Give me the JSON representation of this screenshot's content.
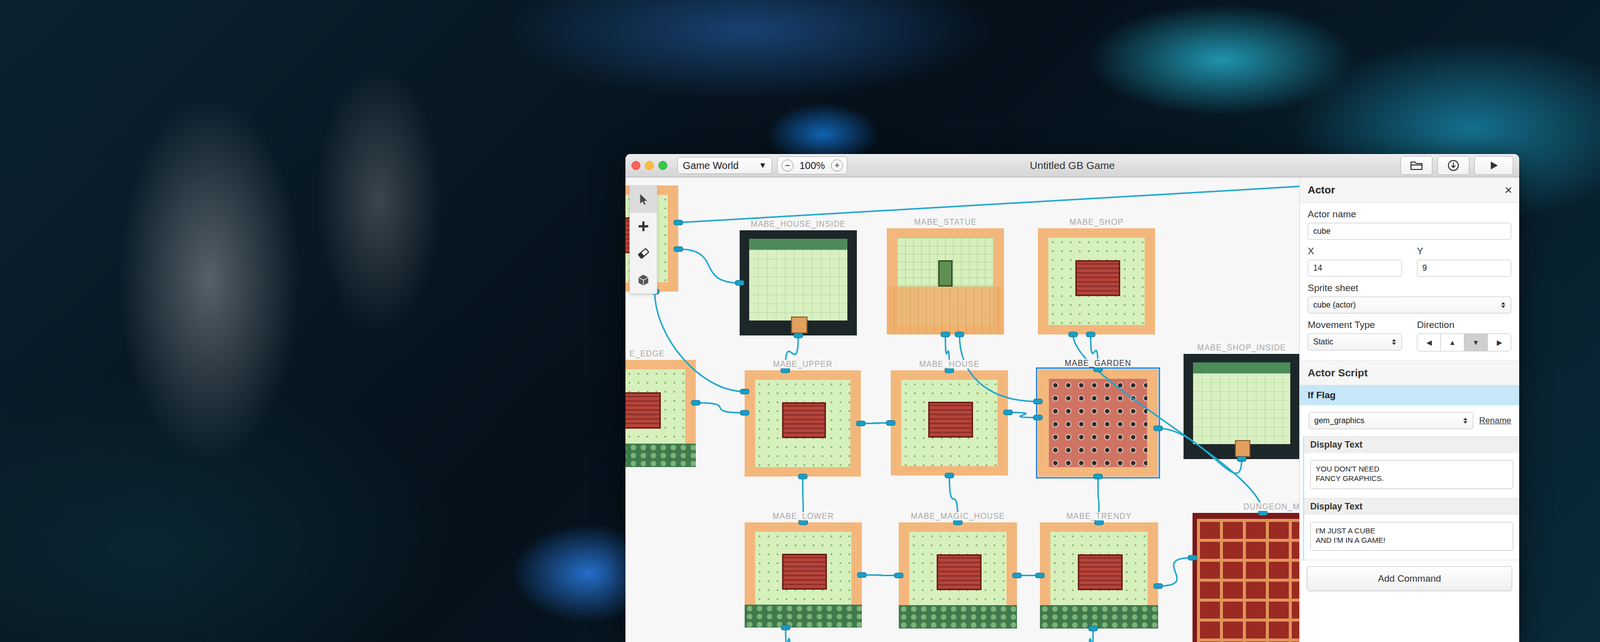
{
  "window": {
    "title": "Untitled GB Game"
  },
  "toolbar": {
    "view": {
      "value": "Game World",
      "arrow": "▼"
    },
    "zoom": {
      "out": "−",
      "level": "100%",
      "in": "+"
    }
  },
  "tools": [
    {
      "kind": "select",
      "selected": true
    },
    {
      "kind": "add",
      "selected": false
    },
    {
      "kind": "erase",
      "selected": false
    },
    {
      "kind": "actor",
      "selected": false
    }
  ],
  "scenes": [
    {
      "name": "",
      "kind": "town",
      "selected": false
    },
    {
      "name": "MABE_HOUSE_INSIDE",
      "kind": "indoor",
      "selected": false
    },
    {
      "name": "MABE_STATUE",
      "kind": "plaza",
      "selected": false
    },
    {
      "name": "MABE_SHOP",
      "kind": "town",
      "selected": false
    },
    {
      "name": "E_EDGE",
      "kind": "forest",
      "selected": false
    },
    {
      "name": "MABE_UPPER",
      "kind": "town",
      "selected": false
    },
    {
      "name": "MABE_HOUSE",
      "kind": "town",
      "selected": false
    },
    {
      "name": "MABE_GARDEN",
      "kind": "garden",
      "selected": true
    },
    {
      "name": "MABE_SHOP_INSIDE",
      "kind": "indoor",
      "selected": false
    },
    {
      "name": "MABE_LOWER",
      "kind": "forest",
      "selected": false
    },
    {
      "name": "MABE_MAGIC_HOUSE",
      "kind": "forest",
      "selected": false
    },
    {
      "name": "MABE_TRENDY",
      "kind": "forest",
      "selected": false
    },
    {
      "name": "DUNGEON_M",
      "kind": "dungeon",
      "selected": false
    }
  ],
  "sidebar": {
    "title": "Actor",
    "close": "×",
    "actor_name": {
      "label": "Actor name",
      "value": "cube"
    },
    "x": {
      "label": "X",
      "value": "14"
    },
    "y": {
      "label": "Y",
      "value": "9"
    },
    "sprite_sheet": {
      "label": "Sprite sheet",
      "value": "cube (actor)"
    },
    "movement_type": {
      "label": "Movement Type",
      "value": "Static"
    },
    "direction": {
      "label": "Direction",
      "options": [
        {
          "label": "◀",
          "selected": false
        },
        {
          "label": "▲",
          "selected": false
        },
        {
          "label": "▼",
          "selected": true
        },
        {
          "label": "▶",
          "selected": false
        }
      ]
    },
    "script": {
      "title": "Actor Script",
      "commands": [
        {
          "kind": "if",
          "label": "If Flag",
          "flag": "gem_graphics",
          "action": "Rename",
          "selected": true,
          "children": [
            {
              "kind": "text",
              "label": "Display Text",
              "text": "YOU DON'T NEED\nFANCY GRAPHICS."
            },
            {
              "kind": "text",
              "label": "Display Text",
              "text": "I'M JUST A CUBE\nAND I'M IN A GAME!"
            }
          ]
        }
      ],
      "add_button": "Add Command"
    }
  }
}
